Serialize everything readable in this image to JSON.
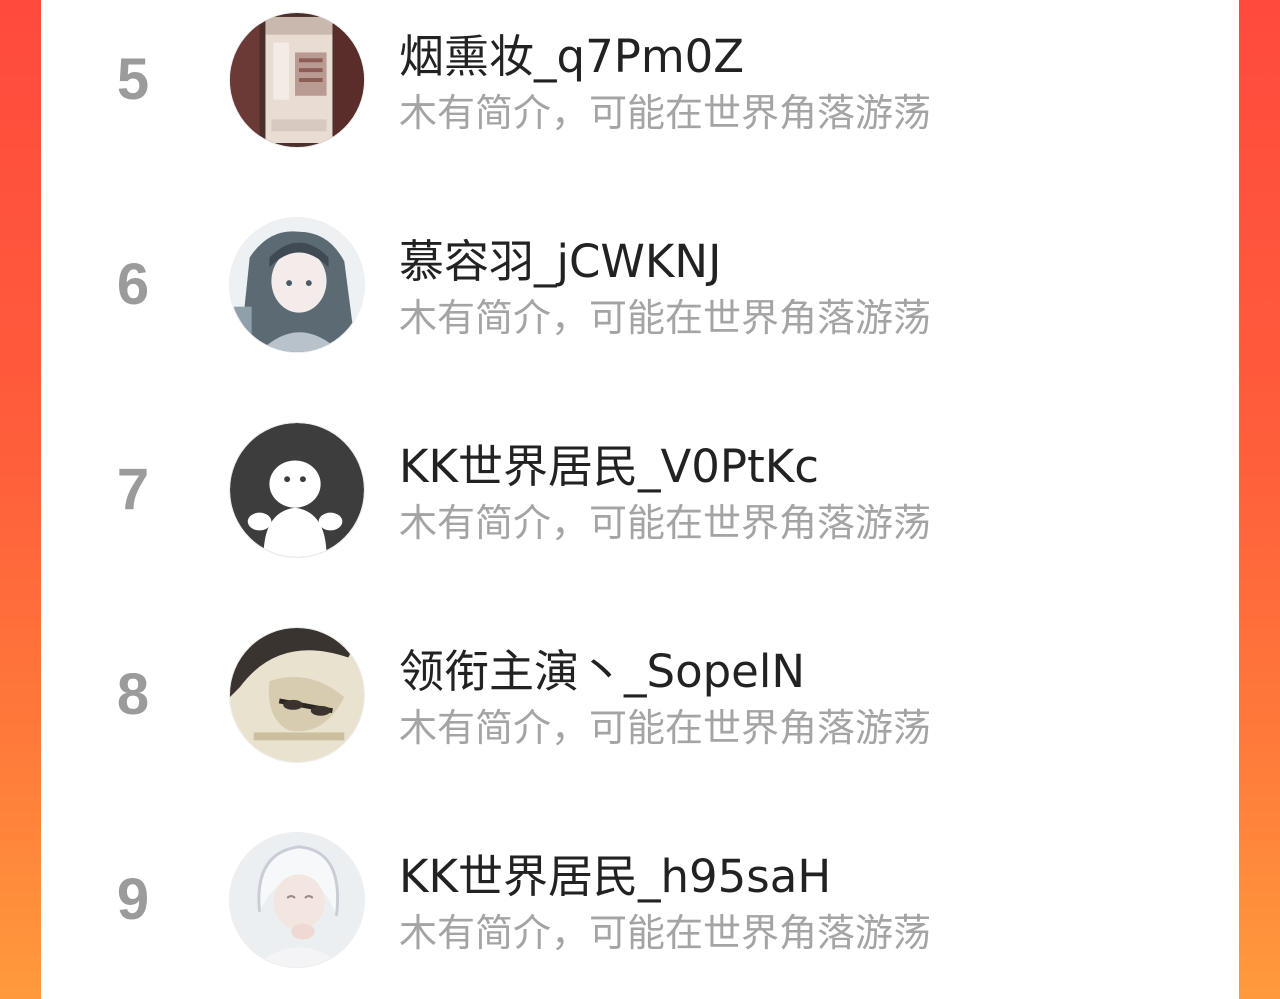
{
  "ranking": {
    "rows": [
      {
        "rank": "5",
        "username": "烟熏妆_q7Pm0Z",
        "bio": "木有简介，可能在世界角落游荡",
        "avatar": "product-bottle-photo"
      },
      {
        "rank": "6",
        "username": "慕容羽_jCWKNJ",
        "bio": "木有简介，可能在世界角落游荡",
        "avatar": "anime-girl-illustration"
      },
      {
        "rank": "7",
        "username": "KK世界居民_V0PtKc",
        "bio": "木有简介，可能在世界角落游荡",
        "avatar": "default-ghost-icon"
      },
      {
        "rank": "8",
        "username": "领衔主演丶_SopelN",
        "bio": "木有简介，可能在世界角落游荡",
        "avatar": "sepia-portrait-photo"
      },
      {
        "rank": "9",
        "username": "KK世界居民_h95saH",
        "bio": "木有简介，可能在世界角落游荡",
        "avatar": "white-haired-anime-illustration"
      }
    ]
  },
  "colors": {
    "background_gradient": [
      "#ff4a3d",
      "#ff9a3c"
    ],
    "panel": "#ffffff",
    "rank_text": "#9b9b9b",
    "username_text": "#222222",
    "bio_text": "#a4a4a4"
  }
}
